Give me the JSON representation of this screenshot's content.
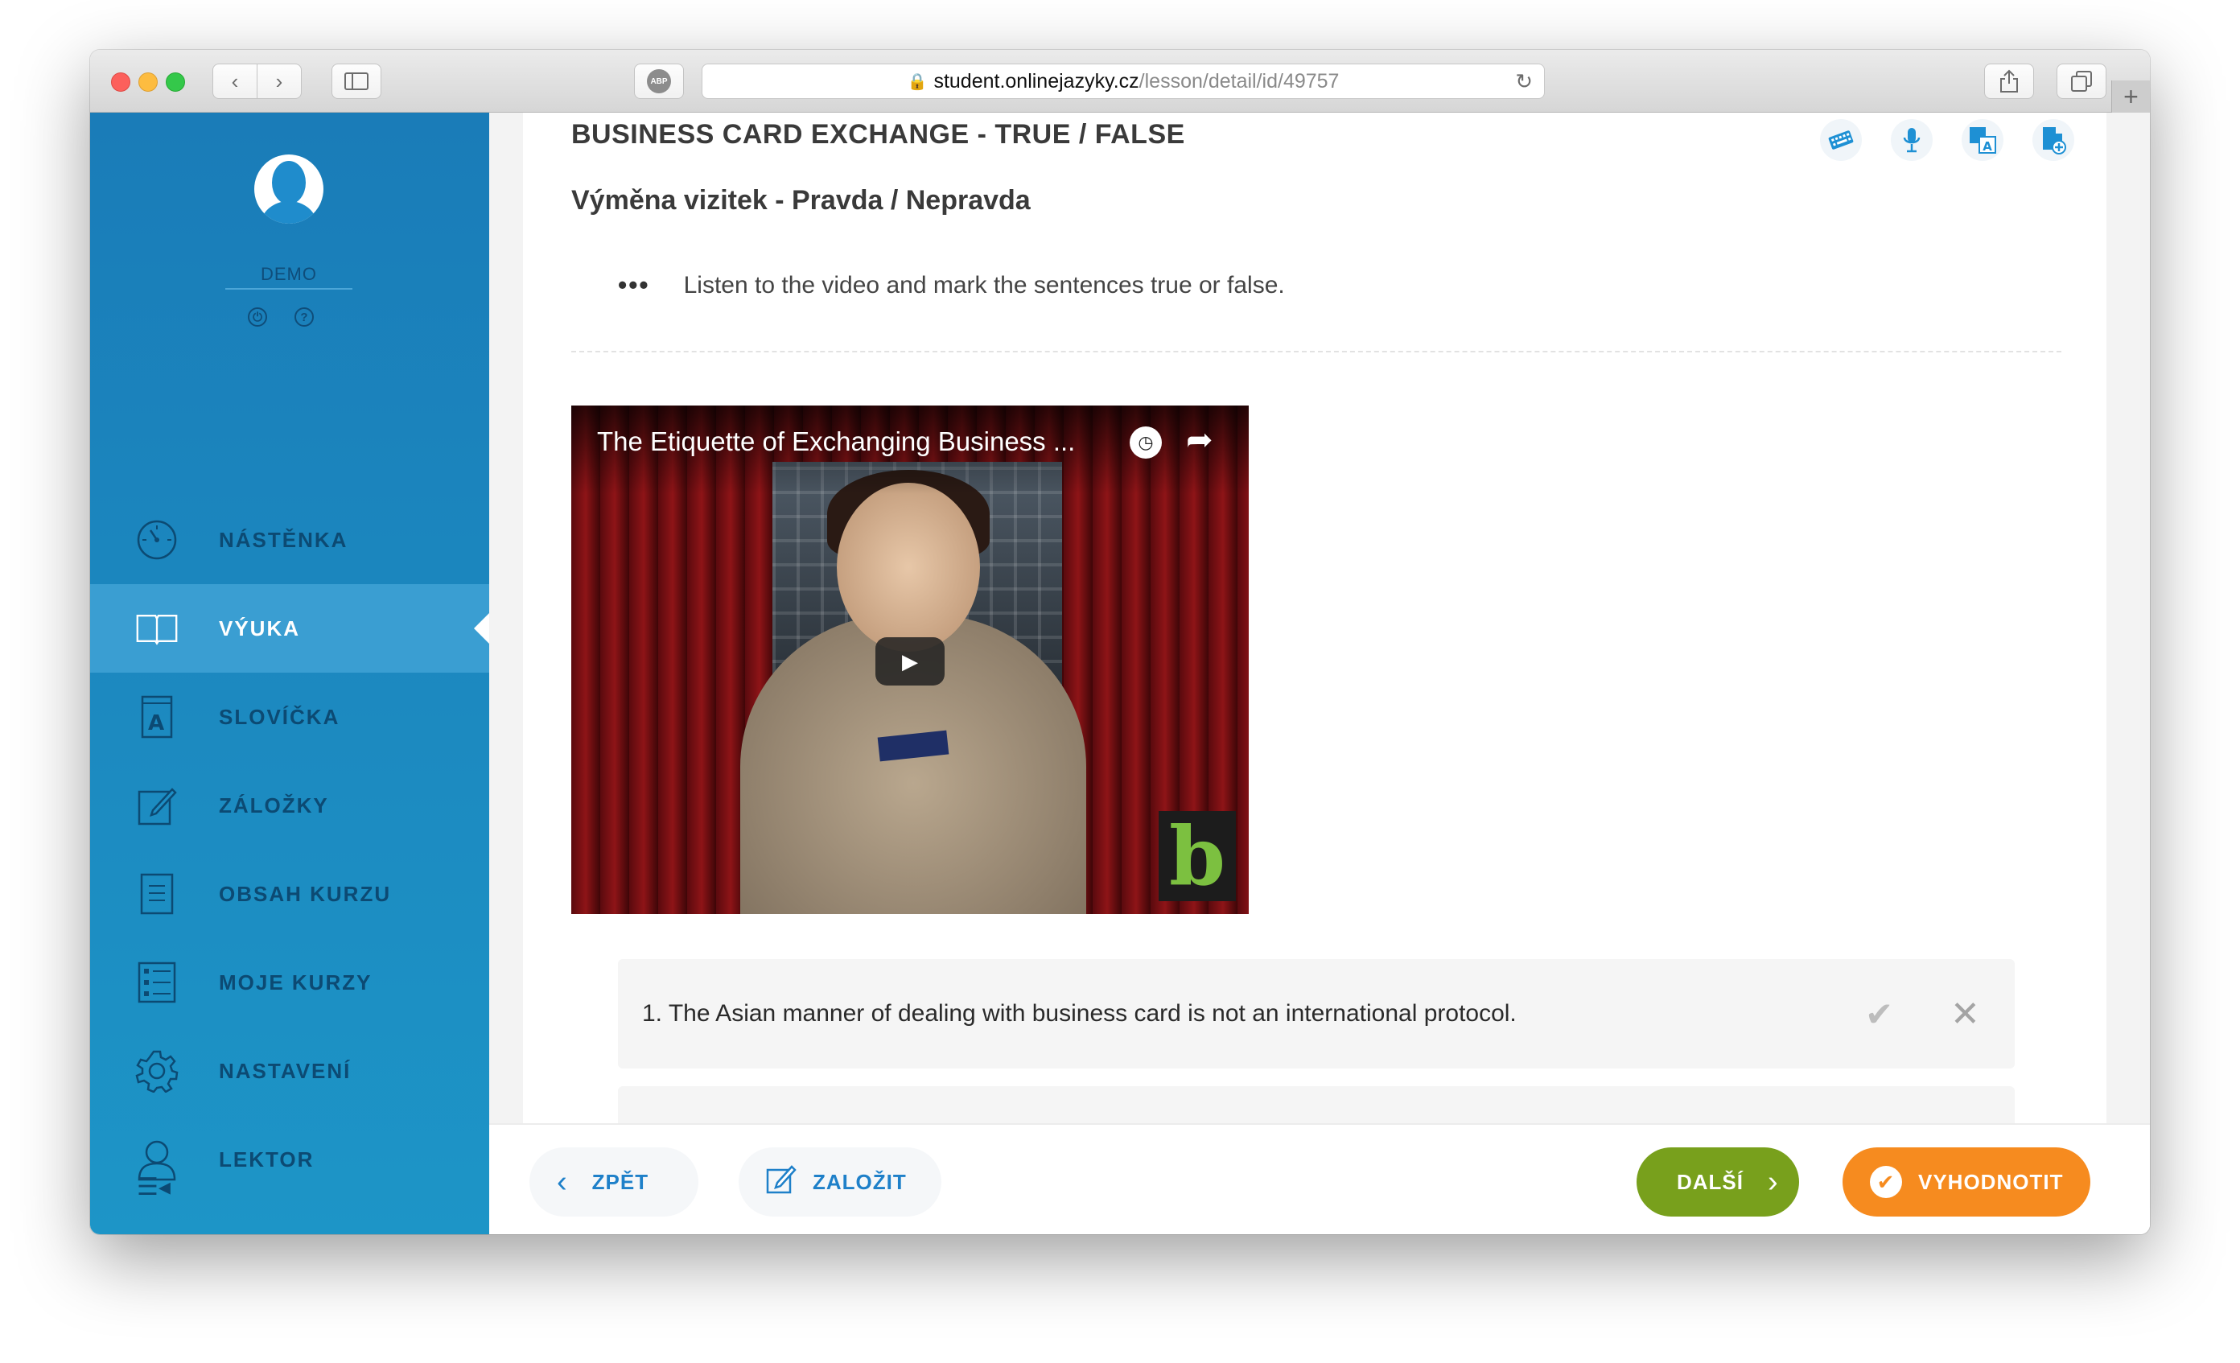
{
  "browser": {
    "url_domain": "student.onlinejazyky.cz",
    "url_path": "/lesson/detail/id/49757",
    "adblock_label": "ABP",
    "icons": [
      "back-icon",
      "forward-icon",
      "sidebar-icon",
      "lock-icon",
      "reload-icon",
      "share-icon",
      "tabs-icon",
      "plus-icon"
    ]
  },
  "sidebar": {
    "user_name": "DEMO",
    "menu": [
      {
        "label": "NÁSTĚNKA",
        "icon": "dashboard-icon"
      },
      {
        "label": "VÝUKA",
        "icon": "book-icon",
        "active": true
      },
      {
        "label": "SLOVÍČKA",
        "icon": "vocabulary-icon"
      },
      {
        "label": "ZÁLOŽKY",
        "icon": "bookmark-edit-icon"
      },
      {
        "label": "OBSAH KURZU",
        "icon": "course-content-icon"
      },
      {
        "label": "MOJE KURZY",
        "icon": "my-courses-icon"
      },
      {
        "label": "NASTAVENÍ",
        "icon": "settings-icon"
      },
      {
        "label": "LEKTOR",
        "icon": "tutor-icon"
      }
    ],
    "colors": {
      "background": "#1a7cb8",
      "active": "#3a9ed2",
      "text": "#0c4a73"
    }
  },
  "lesson": {
    "title": "BUSINESS CARD EXCHANGE - TRUE / FALSE",
    "subtitle": "Výměna vizitek - Pravda / Nepravda",
    "instruction": "Listen to the video and mark the sentences true or false.",
    "tools": [
      "keyboard-icon",
      "microphone-icon",
      "translate-icon",
      "add-note-icon"
    ]
  },
  "video": {
    "title": "The Etiquette of Exchanging Business ...",
    "channel_logo": "b"
  },
  "questions": [
    {
      "text": "1. The Asian manner of dealing with business card is not an international protocol."
    }
  ],
  "footer": {
    "back_label": "ZPĚT",
    "bookmark_label": "ZALOŽIT",
    "next_label": "DALŠÍ",
    "evaluate_label": "VYHODNOTIT",
    "colors": {
      "next": "#78a01c",
      "evaluate": "#f68b1f",
      "secondary_text": "#1e80c9"
    }
  }
}
